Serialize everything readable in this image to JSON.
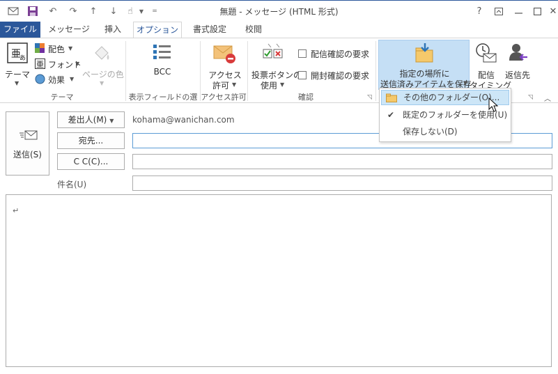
{
  "window": {
    "title": "無題 - メッセージ (HTML 形式)",
    "help_label": "?",
    "accent": "#2b579a"
  },
  "qat": {
    "icons": [
      "mail-icon",
      "save-icon",
      "undo-icon",
      "redo-icon",
      "up-arrow-icon",
      "down-arrow-icon",
      "touch-mode-icon",
      "customize-icon"
    ]
  },
  "tabs": [
    {
      "label": "ファイル"
    },
    {
      "label": "メッセージ"
    },
    {
      "label": "挿入"
    },
    {
      "label": "オプション"
    },
    {
      "label": "書式設定"
    },
    {
      "label": "校閲"
    }
  ],
  "ribbon": {
    "theme_group": {
      "theme_label": "テーマ",
      "colors_label": "配色",
      "fonts_label": "フォント",
      "effects_label": "効果",
      "page_color_label": "ページの色",
      "group_label": "テーマ"
    },
    "fields_group": {
      "bcc_label": "BCC",
      "group_label": "表示フィールドの選択"
    },
    "permission_group": {
      "label_line1": "アクセス",
      "label_line2": "許可",
      "group_label": "アクセス許可"
    },
    "tracking_group": {
      "vote_line1": "投票ボタンの",
      "vote_line2": "使用",
      "delivery_receipt_label": "配信確認の要求",
      "read_receipt_label": "開封確認の要求",
      "group_label": "確認"
    },
    "more_group": {
      "save_sent_line1": "指定の場所に",
      "save_sent_line2": "送信済みアイテムを保存",
      "delay_line1": "配信",
      "delay_line2": "タイミング",
      "reply_label": "返信先"
    }
  },
  "menu": {
    "items": [
      {
        "label": "その他のフォルダー(O)..."
      },
      {
        "label": "既定のフォルダーを使用(U)"
      },
      {
        "label": "保存しない(D)"
      }
    ]
  },
  "compose": {
    "send_label": "送信(S)",
    "from_label": "差出人(M)",
    "from_value": "kohama@wanichan.com",
    "to_label": "宛先...",
    "cc_label": "C C(C)...",
    "subject_label": "件名(U)",
    "body_mark": "↵"
  }
}
